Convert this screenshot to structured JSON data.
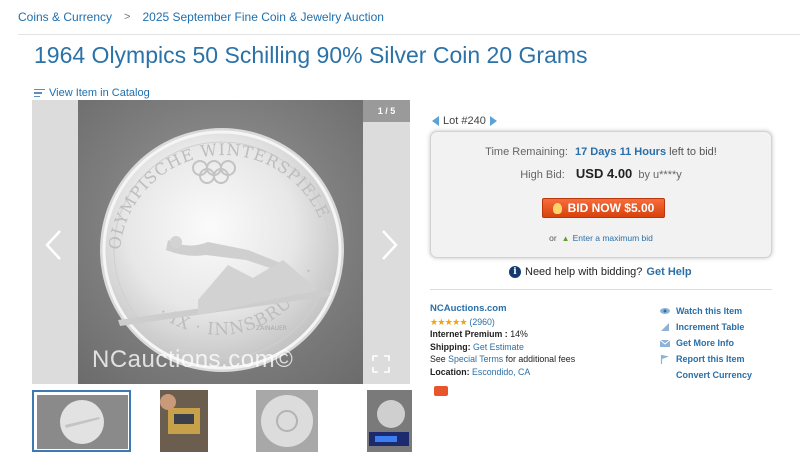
{
  "breadcrumb": {
    "items": [
      "Coins & Currency",
      "2025 September Fine Coin & Jewelry Auction"
    ],
    "separator": ">"
  },
  "title": "1964 Olympics 50 Schilling 90% Silver Coin 20 Grams",
  "catalog_link": "View Item in Catalog",
  "gallery": {
    "counter": "1 / 5",
    "watermark": "NCauctions.com©",
    "coin_inscription": "OLYMPISCHE WINTERSPIELE 1964 · IX · INNSBRUCK",
    "engraver": "ZAINAUER"
  },
  "lot": {
    "label": "Lot #240"
  },
  "bid_box": {
    "time_label": "Time Remaining:",
    "time_value": "17 Days 11 Hours",
    "time_suffix": "left to bid!",
    "high_label": "High Bid:",
    "high_amount": "USD 4.00",
    "high_by": "by u****y",
    "bid_button": "BID NOW $5.00",
    "max_prefix": "or",
    "max_link": "Enter a maximum bid"
  },
  "help": {
    "text": "Need help with bidding?",
    "link": "Get Help"
  },
  "seller": {
    "name": "NCAuctions.com",
    "stars": "★★★★★",
    "rating_count": "(2960)",
    "premium_label": "Internet Premium :",
    "premium_value": "14%",
    "shipping_label": "Shipping:",
    "shipping_link": "Get Estimate",
    "terms_prefix": "See",
    "terms_link": "Special Terms",
    "terms_suffix": "for additional fees",
    "location_label": "Location:",
    "location_value": "Escondido, CA"
  },
  "actions": {
    "watch": "Watch this Item",
    "increment": "Increment Table",
    "more_info": "Get More Info",
    "report": "Report this Item",
    "convert": "Convert Currency"
  },
  "colors": {
    "link": "#2a6fa8",
    "title": "#2a72a8",
    "bid_button": "#e8542b",
    "stars": "#f2a20c"
  }
}
